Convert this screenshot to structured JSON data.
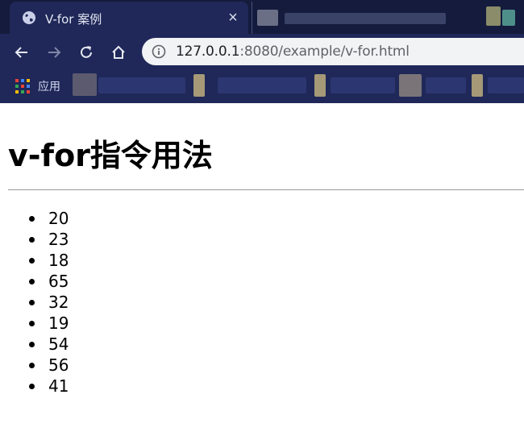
{
  "browser": {
    "tab": {
      "title": "V-for 案例",
      "close_symbol": "×",
      "favicon": "globe-icon"
    },
    "address_bar": {
      "host": "127.0.0.1",
      "rest": ":8080/example/v-for.html",
      "info_icon": "info-icon"
    },
    "nav": {
      "back": "arrow-left-icon",
      "forward": "arrow-right-icon",
      "reload": "reload-icon",
      "home": "home-icon"
    },
    "bookmarks": {
      "apps_label": "应用",
      "apps_icon": "apps-grid-icon"
    },
    "colors": {
      "chrome": "#1f2858",
      "tabstrip": "#141b3c",
      "omnibox": "#f1f3f4"
    }
  },
  "page": {
    "title": "v-for指令用法",
    "items": [
      "20",
      "23",
      "18",
      "65",
      "32",
      "19",
      "54",
      "56",
      "41"
    ]
  }
}
